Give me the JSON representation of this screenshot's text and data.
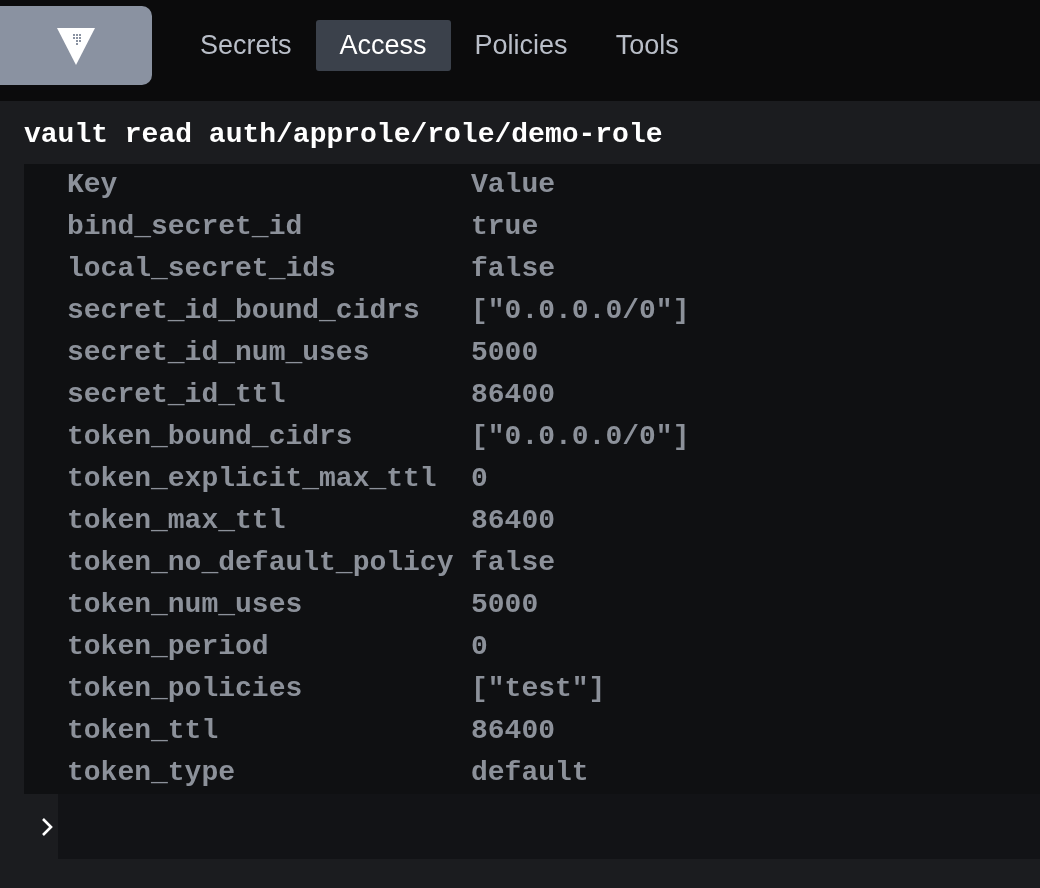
{
  "nav": {
    "tabs": [
      {
        "label": "Secrets",
        "selected": false
      },
      {
        "label": "Access",
        "selected": true
      },
      {
        "label": "Policies",
        "selected": false
      },
      {
        "label": "Tools",
        "selected": false
      }
    ]
  },
  "console": {
    "command": "vault read auth/approle/role/demo-role",
    "output": {
      "columns": [
        "Key",
        "Value"
      ],
      "rows": [
        [
          "bind_secret_id",
          "true"
        ],
        [
          "local_secret_ids",
          "false"
        ],
        [
          "secret_id_bound_cidrs",
          "[\"0.0.0.0/0\"]"
        ],
        [
          "secret_id_num_uses",
          "5000"
        ],
        [
          "secret_id_ttl",
          "86400"
        ],
        [
          "token_bound_cidrs",
          "[\"0.0.0.0/0\"]"
        ],
        [
          "token_explicit_max_ttl",
          "0"
        ],
        [
          "token_max_ttl",
          "86400"
        ],
        [
          "token_no_default_policy",
          "false"
        ],
        [
          "token_num_uses",
          "5000"
        ],
        [
          "token_period",
          "0"
        ],
        [
          "token_policies",
          "[\"test\"]"
        ],
        [
          "token_ttl",
          "86400"
        ],
        [
          "token_type",
          "default"
        ]
      ]
    }
  }
}
